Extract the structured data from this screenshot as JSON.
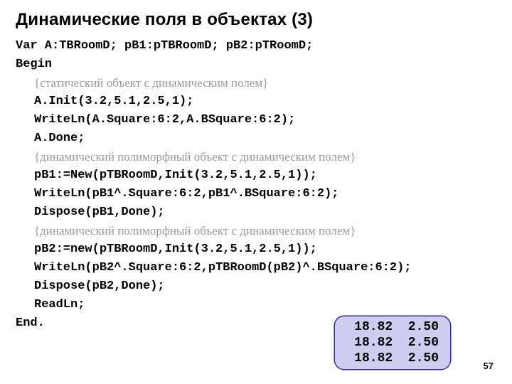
{
  "title": "Динамические поля в объектах (3)",
  "lines": [
    {
      "cls": "",
      "text": "Var A:TBRoomD; pB1:pTBRoomD; pB2:pTRoomD;"
    },
    {
      "cls": "",
      "text": "Begin"
    },
    {
      "cls": "indent1 comment",
      "text": "{статический объект с динамическим полем}"
    },
    {
      "cls": "indent1",
      "text": "A.Init(3.2,5.1,2.5,1);"
    },
    {
      "cls": "indent1",
      "text": "WriteLn(A.Square:6:2,A.BSquare:6:2);"
    },
    {
      "cls": "indent1",
      "text": "A.Done;"
    },
    {
      "cls": "indent1 comment",
      "text": "{динамический полиморфный объект с динамическим полем}"
    },
    {
      "cls": "indent1",
      "text": "pB1:=New(pTBRoomD,Init(3.2,5.1,2.5,1));"
    },
    {
      "cls": "indent1",
      "text": "WriteLn(pB1^.Square:6:2,pB1^.BSquare:6:2);"
    },
    {
      "cls": "indent1",
      "text": "Dispose(pB1,Done);"
    },
    {
      "cls": "indent1 comment",
      "text": "{динамический полиморфный объект с динамическим полем}"
    },
    {
      "cls": "indent1",
      "text": "pB2:=new(pTBRoomD,Init(3.2,5.1,2.5,1));"
    },
    {
      "cls": "indent1",
      "text": "WriteLn(pB2^.Square:6:2,pTBRoomD(pB2)^.BSquare:6:2);"
    },
    {
      "cls": "indent1",
      "text": "Dispose(pB2,Done);"
    },
    {
      "cls": "indent1",
      "text": "ReadLn;"
    },
    {
      "cls": "",
      "text": "End."
    }
  ],
  "output_lines": [
    " 18.82  2.50",
    " 18.82  2.50",
    " 18.82  2.50"
  ],
  "page_number": "57"
}
